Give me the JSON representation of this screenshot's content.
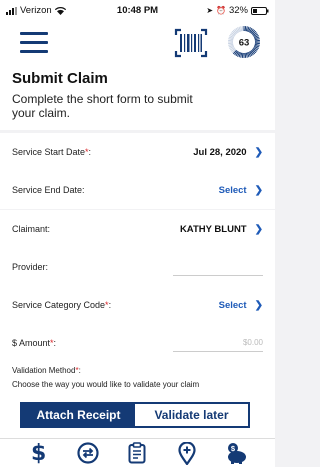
{
  "status": {
    "carrier": "Verizon",
    "time": "10:48 PM",
    "battery": "32%"
  },
  "header": {
    "score": "63",
    "title": "Submit Claim",
    "subtitle": "Complete the short form to submit your claim."
  },
  "dates": {
    "start_label": "Service Start Date",
    "start_value": "Jul 28, 2020",
    "end_label": "Service End Date:",
    "end_value": "Select"
  },
  "details": {
    "claimant_label": "Claimant:",
    "claimant_value": "KATHY BLUNT",
    "provider_label": "Provider:",
    "category_label": "Service Category Code",
    "category_value": "Select",
    "amount_label": "$ Amount",
    "amount_placeholder": "$0.00"
  },
  "validation": {
    "title": "Validation Method",
    "description": "Choose the way you would like to validate your claim",
    "option_attach": "Attach Receipt",
    "option_later": "Validate later"
  },
  "tabs": [
    "dollar-icon",
    "exchange-icon",
    "clipboard-icon",
    "location-pin-icon",
    "piggy-bank-icon"
  ],
  "colors": {
    "primary": "#143a75",
    "link": "#1f5bb8",
    "required": "#d9262a"
  }
}
